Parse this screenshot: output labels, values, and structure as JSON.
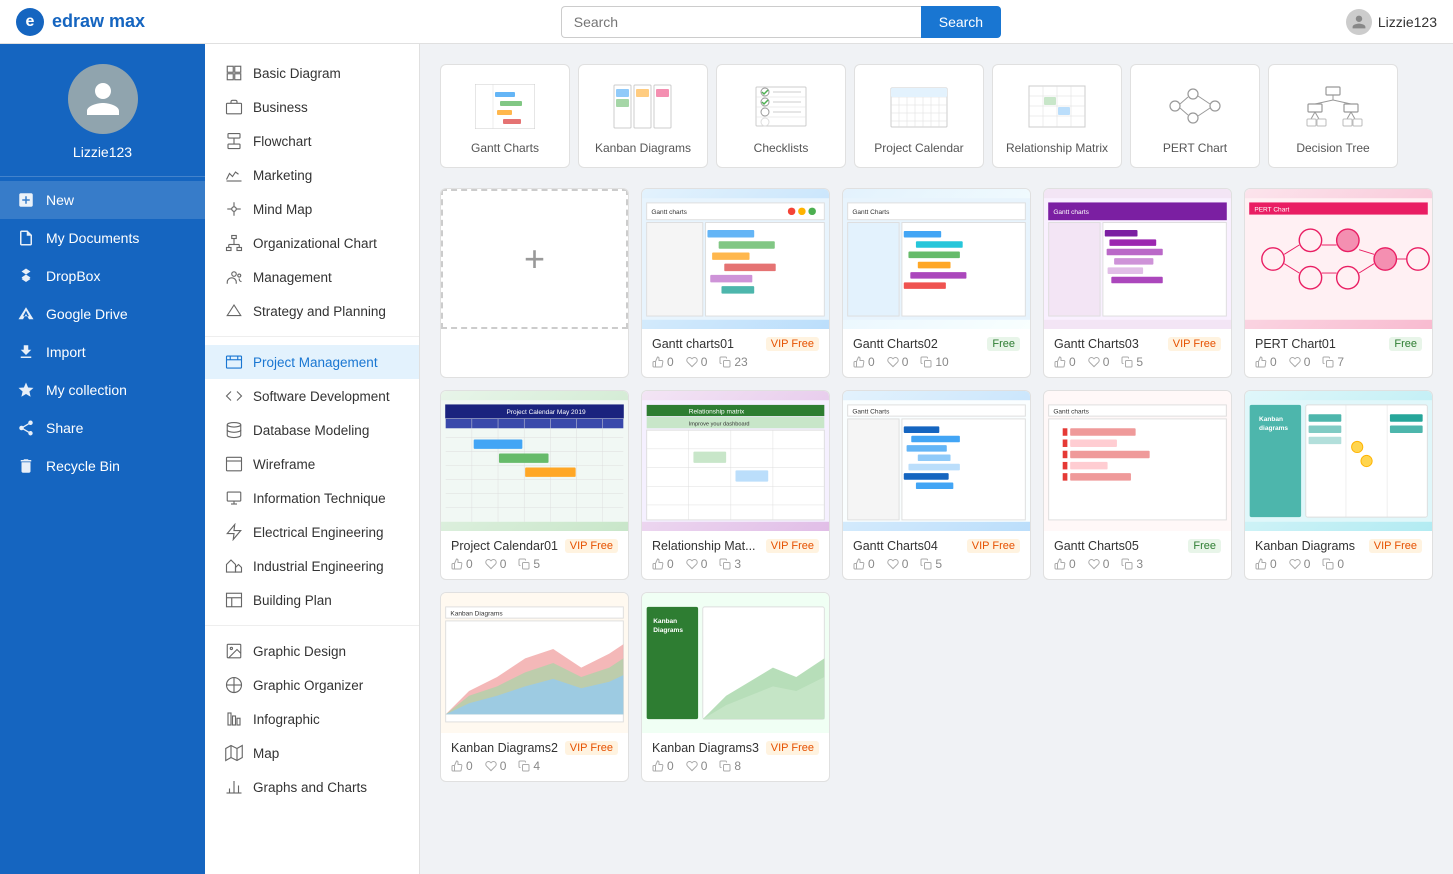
{
  "app": {
    "name": "edraw max",
    "logo_letter": "e"
  },
  "header": {
    "search_placeholder": "Search",
    "search_button": "Search",
    "username": "Lizzie123"
  },
  "sidebar": {
    "username": "Lizzie123",
    "nav_items": [
      {
        "id": "new",
        "label": "New",
        "icon": "plus"
      },
      {
        "id": "my-documents",
        "label": "My Documents",
        "icon": "file"
      },
      {
        "id": "dropbox",
        "label": "DropBox",
        "icon": "dropbox"
      },
      {
        "id": "google-drive",
        "label": "Google Drive",
        "icon": "gdrive"
      },
      {
        "id": "import",
        "label": "Import",
        "icon": "import"
      },
      {
        "id": "my-collection",
        "label": "My collection",
        "icon": "star"
      },
      {
        "id": "share",
        "label": "Share",
        "icon": "share"
      },
      {
        "id": "recycle-bin",
        "label": "Recycle Bin",
        "icon": "trash"
      }
    ]
  },
  "left_panel": {
    "items": [
      {
        "id": "basic-diagram",
        "label": "Basic Diagram",
        "active": false
      },
      {
        "id": "business",
        "label": "Business",
        "active": false
      },
      {
        "id": "flowchart",
        "label": "Flowchart",
        "active": false
      },
      {
        "id": "marketing",
        "label": "Marketing",
        "active": false
      },
      {
        "id": "mind-map",
        "label": "Mind Map",
        "active": false
      },
      {
        "id": "organizational-chart",
        "label": "Organizational Chart",
        "active": false
      },
      {
        "id": "management",
        "label": "Management",
        "active": false
      },
      {
        "id": "strategy-planning",
        "label": "Strategy and Planning",
        "active": false
      },
      {
        "id": "project-management",
        "label": "Project Management",
        "active": true
      },
      {
        "id": "software-development",
        "label": "Software Development",
        "active": false
      },
      {
        "id": "database-modeling",
        "label": "Database Modeling",
        "active": false
      },
      {
        "id": "wireframe",
        "label": "Wireframe",
        "active": false
      },
      {
        "id": "information-technique",
        "label": "Information Technique",
        "active": false
      },
      {
        "id": "electrical-engineering",
        "label": "Electrical Engineering",
        "active": false
      },
      {
        "id": "industrial-engineering",
        "label": "Industrial Engineering",
        "active": false
      },
      {
        "id": "building-plan",
        "label": "Building Plan",
        "active": false
      },
      {
        "id": "graphic-design",
        "label": "Graphic Design",
        "active": false
      },
      {
        "id": "graphic-organizer",
        "label": "Graphic Organizer",
        "active": false
      },
      {
        "id": "infographic",
        "label": "Infographic",
        "active": false
      },
      {
        "id": "map",
        "label": "Map",
        "active": false
      },
      {
        "id": "graphs-charts",
        "label": "Graphs and Charts",
        "active": false
      }
    ]
  },
  "category_cards": [
    {
      "id": "gantt-charts",
      "label": "Gantt Charts"
    },
    {
      "id": "kanban-diagrams",
      "label": "Kanban Diagrams"
    },
    {
      "id": "checklists",
      "label": "Checklists"
    },
    {
      "id": "project-calendar",
      "label": "Project Calendar"
    },
    {
      "id": "relationship-matrix",
      "label": "Relationship Matrix"
    },
    {
      "id": "pert-chart",
      "label": "PERT Chart"
    },
    {
      "id": "decision-tree",
      "label": "Decision Tree"
    }
  ],
  "templates": [
    {
      "id": "new",
      "type": "new",
      "name": "",
      "badge": "",
      "likes": null,
      "hearts": null,
      "copies": null
    },
    {
      "id": "gantt01",
      "type": "gantt",
      "name": "Gantt charts01",
      "badge": "VIP Free",
      "badge_type": "vip",
      "likes": 0,
      "hearts": 0,
      "copies": 23
    },
    {
      "id": "gantt02",
      "type": "gantt2",
      "name": "Gantt Charts02",
      "badge": "Free",
      "badge_type": "free",
      "likes": 0,
      "hearts": 0,
      "copies": 10
    },
    {
      "id": "gantt03",
      "type": "gantt3",
      "name": "Gantt Charts03",
      "badge": "VIP Free",
      "badge_type": "vip",
      "likes": 0,
      "hearts": 0,
      "copies": 5
    },
    {
      "id": "pert01",
      "type": "pert",
      "name": "PERT Chart01",
      "badge": "Free",
      "badge_type": "free",
      "likes": 0,
      "hearts": 0,
      "copies": 7
    },
    {
      "id": "calendar01",
      "type": "calendar",
      "name": "Project Calendar01",
      "badge": "VIP Free",
      "badge_type": "vip",
      "likes": 0,
      "hearts": 0,
      "copies": 5
    },
    {
      "id": "relationship01",
      "type": "relationship",
      "name": "Relationship Mat...",
      "badge": "VIP Free",
      "badge_type": "vip",
      "likes": 0,
      "hearts": 0,
      "copies": 3
    },
    {
      "id": "gantt04",
      "type": "gantt4",
      "name": "Gantt Charts04",
      "badge": "VIP Free",
      "badge_type": "vip",
      "likes": 0,
      "hearts": 0,
      "copies": 5
    },
    {
      "id": "gantt05",
      "type": "gantt5",
      "name": "Gantt Charts05",
      "badge": "Free",
      "badge_type": "free",
      "likes": 0,
      "hearts": 0,
      "copies": 3
    },
    {
      "id": "kanban01",
      "type": "kanban",
      "name": "Kanban Diagrams",
      "badge": "VIP Free",
      "badge_type": "vip",
      "likes": 0,
      "hearts": 0,
      "copies": 0
    },
    {
      "id": "kanban02",
      "type": "kanban2",
      "name": "Kanban Diagrams2",
      "badge": "VIP Free",
      "badge_type": "vip",
      "likes": 0,
      "hearts": 0,
      "copies": 4
    },
    {
      "id": "kanban03",
      "type": "kanban3",
      "name": "Kanban Diagrams3",
      "badge": "VIP Free",
      "badge_type": "vip",
      "likes": 0,
      "hearts": 0,
      "copies": 8
    }
  ]
}
